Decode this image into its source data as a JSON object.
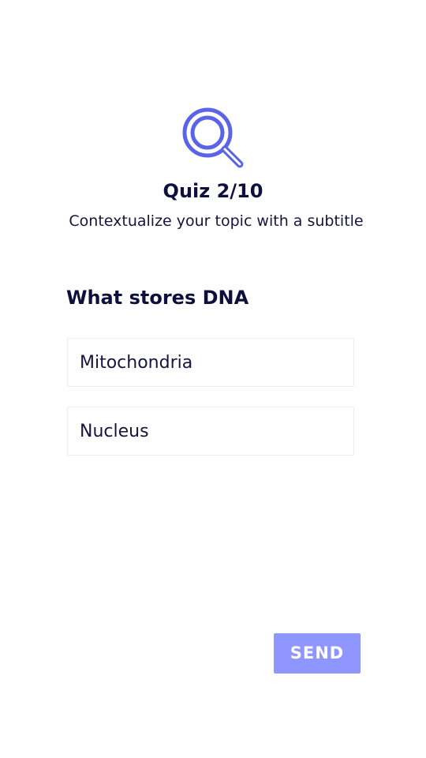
{
  "header": {
    "icon": "search-icon",
    "title": "Quiz 2/10",
    "subtitle": "Contextualize your topic with a subtitle"
  },
  "question": {
    "text": "What stores DNA",
    "options": [
      {
        "label": "Mitochondria"
      },
      {
        "label": "Nucleus"
      }
    ]
  },
  "actions": {
    "send_label": "SEND"
  },
  "colors": {
    "accent": "#5b63e6",
    "button_bg": "#8f96ff",
    "text_dark": "#0f0f3d",
    "background": "#ffffff",
    "option_border": "#ececf0"
  }
}
